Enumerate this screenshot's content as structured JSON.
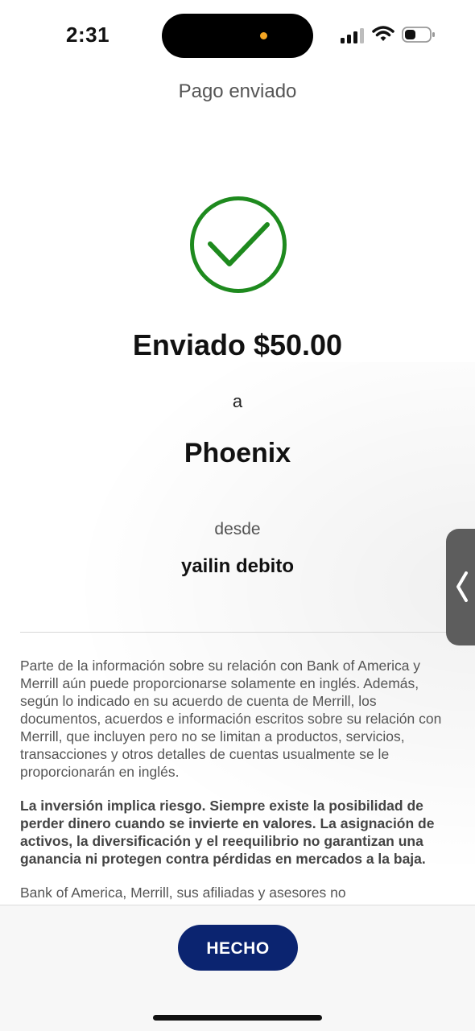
{
  "status_bar": {
    "time": "2:31",
    "icons": [
      "cellular-signal-icon",
      "wifi-icon",
      "battery-icon"
    ]
  },
  "header": {
    "title": "Pago enviado"
  },
  "confirmation": {
    "icon": "checkmark-circle-icon",
    "icon_color": "#1e8a1e",
    "sent_amount": "Enviado $50.00",
    "to_label": "a",
    "recipient": "Phoenix",
    "from_label": "desde",
    "from_account": "yailin debito"
  },
  "disclosures": {
    "paragraph_1": "Parte de la información sobre su relación con Bank of America y Merrill aún puede proporcionarse solamente en inglés. Además, según lo indicado en su acuerdo de cuenta de Merrill, los documentos, acuerdos e información escritos sobre su relación con Merrill, que incluyen pero no se limitan a productos, servicios, transacciones y otros detalles de cuentas usualmente se le proporcionarán en inglés.",
    "paragraph_2": "La inversión implica riesgo. Siempre existe la posibilidad de perder dinero cuando se invierte en valores. La asignación de activos, la diversificación y el reequilibrio no garantizan una ganancia ni protegen contra pérdidas en mercados a la baja.",
    "paragraph_3": "Bank of America, Merrill, sus afiliadas y asesores no"
  },
  "footer": {
    "done_label": "HECHO",
    "done_color": "#0b2470"
  },
  "side_handle": {
    "icon": "chevron-left-icon"
  }
}
